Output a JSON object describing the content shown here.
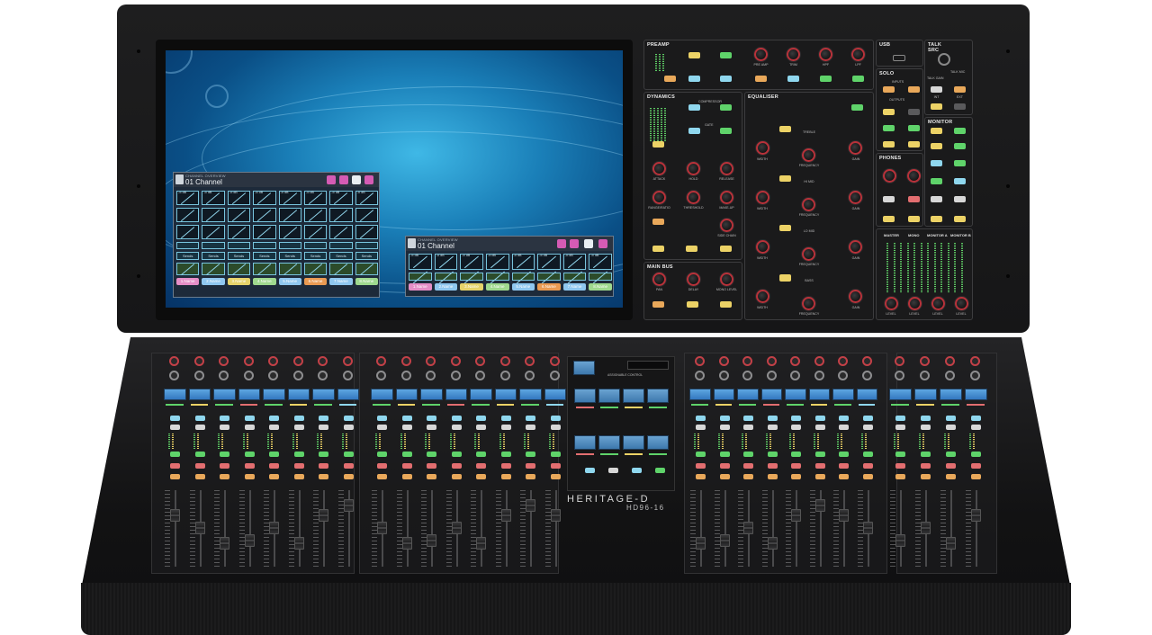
{
  "screen": {
    "overview_left": {
      "subtitle": "CHANNEL OVERVIEW",
      "title": "01 Channel",
      "db_label": "-∞ dB",
      "sends_label": "Sends",
      "names": [
        "1.Name",
        "2.Name",
        "3.Name",
        "4.Name",
        "5.Name",
        "6.Name",
        "7.Name",
        "8.Name"
      ]
    },
    "overview_right": {
      "subtitle": "CHANNEL OVERVIEW",
      "title": "01 Channel",
      "db_label": "-∞ dB",
      "names": [
        "1.Name",
        "2.Name",
        "3.Name",
        "4.Name",
        "5.Name",
        "6.Name",
        "7.Name",
        "8.Name"
      ]
    },
    "name_colors": [
      "#e58ec6",
      "#8fc7ef",
      "#e6d36a",
      "#9fd98e",
      "#8fc7ef",
      "#e99a52",
      "#8fc7ef",
      "#9fd98e"
    ]
  },
  "panels": {
    "preamp": {
      "title": "PREAMP",
      "knobs": [
        "PRE AMP",
        "TRIM",
        "HPF",
        "LPF"
      ]
    },
    "dynamics": {
      "title": "DYNAMICS",
      "labels": {
        "compressor": "COMPRESSOR",
        "gate": "GATE"
      },
      "knobs": [
        "ATTACK",
        "HOLD",
        "RELEASE",
        "RANGE/RATIO",
        "THRESHOLD",
        "MAKE-UP",
        "SIDE CHAIN"
      ]
    },
    "equaliser": {
      "title": "EQUALISER",
      "bands": [
        "TREBLE",
        "HI MID",
        "LO MID",
        "BASS"
      ],
      "knob_labels": {
        "width": "WIDTH",
        "frequency": "FREQUENCY",
        "gain": "GAIN"
      }
    },
    "main_bus": {
      "title": "MAIN BUS",
      "knobs": [
        "PAN",
        "DELAY",
        "MONO LEVEL"
      ]
    },
    "usb": {
      "title": "USB"
    },
    "talk": {
      "title": "TALK SRC",
      "labels": {
        "talk_mic": "TALK MIC",
        "talk_gain": "TALK GAIN"
      }
    },
    "solo": {
      "title": "SOLO",
      "labels": {
        "inputs": "INPUTS",
        "outputs": "OUTPUTS",
        "int": "INT",
        "ext": "EXT"
      }
    },
    "monitor": {
      "title": "MONITOR"
    },
    "phones": {
      "title": "PHONES"
    },
    "meters": {
      "labels": [
        "MASTER",
        "MONO",
        "MONITOR A",
        "MONITOR B"
      ],
      "level": "LEVEL"
    }
  },
  "surface": {
    "center": {
      "assignable": "ASSIGNABLE CONTROL"
    },
    "brand": "HERITAGE-D",
    "model": "HD96-16"
  },
  "colors": {
    "screen_bg": "#1a7fb8",
    "knob_ring": "#b8323a",
    "accent_green": "#5fd36a",
    "accent_yellow": "#ecd266",
    "accent_blue": "#8fd7ee"
  }
}
